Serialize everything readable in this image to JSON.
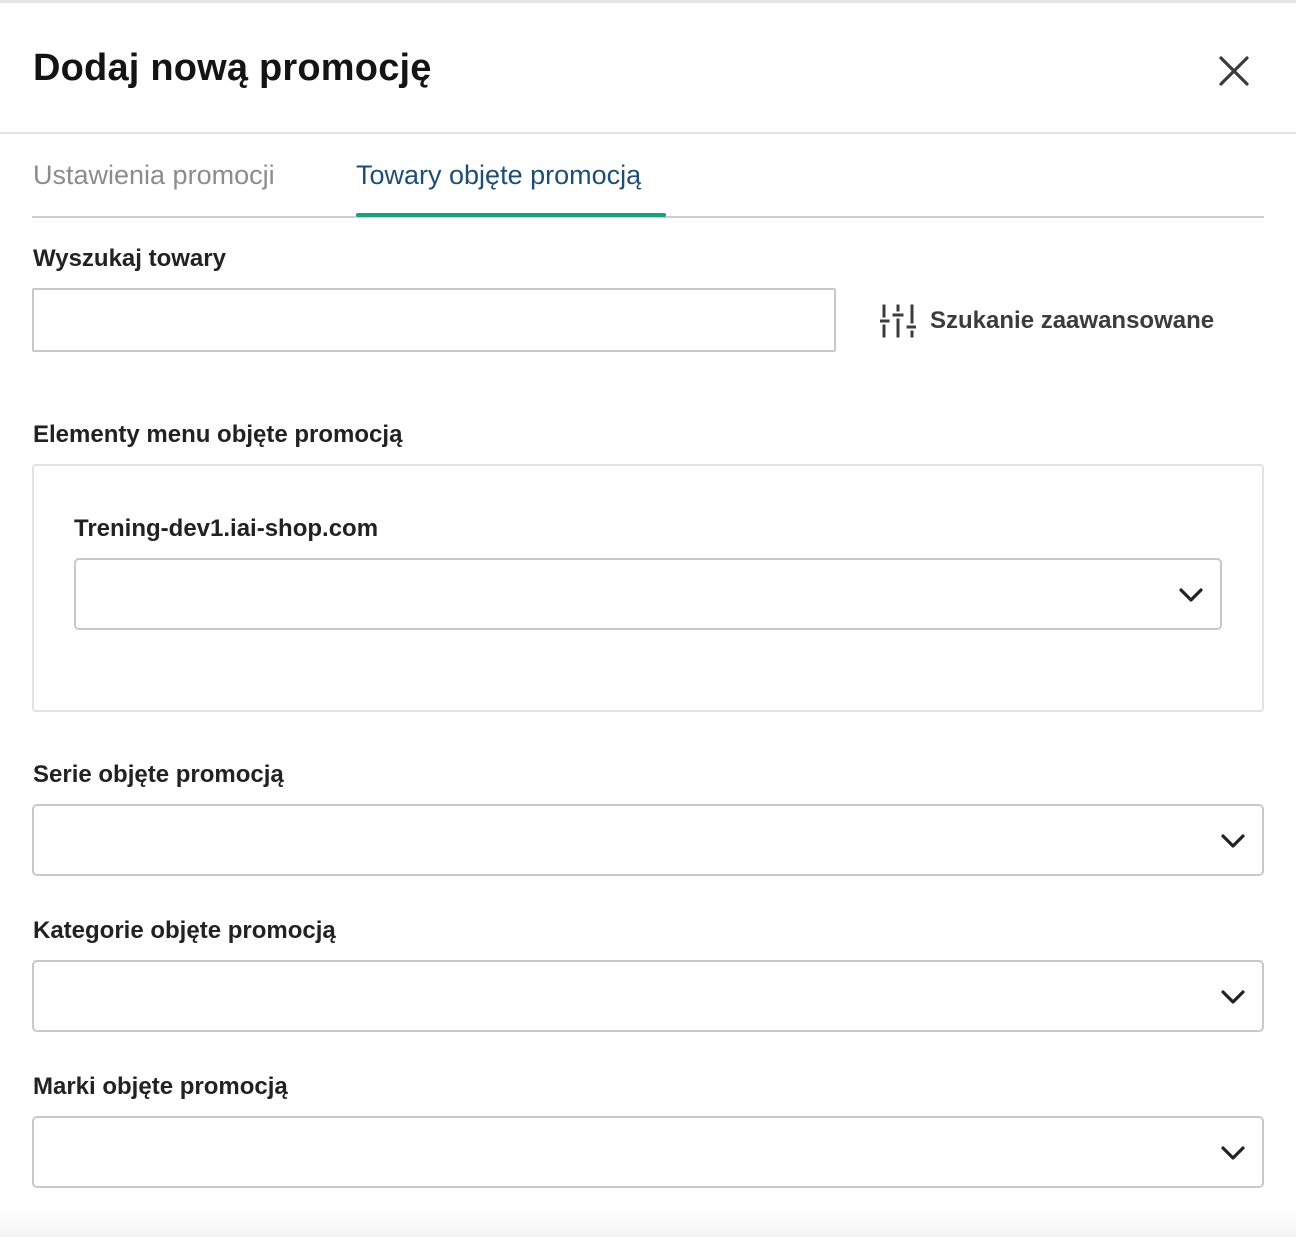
{
  "modal": {
    "title": "Dodaj nową promocję",
    "close_icon": "close-icon"
  },
  "tabs": [
    {
      "label": "Ustawienia promocji",
      "active": false
    },
    {
      "label": "Towary objęte promocją",
      "active": true
    }
  ],
  "search": {
    "label": "Wyszukaj towary",
    "value": "",
    "advanced_label": "Szukanie zaawansowane",
    "advanced_icon": "sliders-icon"
  },
  "menu_elements": {
    "label": "Elementy menu objęte promocją",
    "shop_label": "Trening-dev1.iai-shop.com",
    "select_value": ""
  },
  "series": {
    "label": "Serie objęte promocją",
    "select_value": ""
  },
  "categories": {
    "label": "Kategorie objęte promocją",
    "select_value": ""
  },
  "brands": {
    "label": "Marki objęte promocją",
    "select_value": ""
  },
  "colors": {
    "active_tab": "#1e4e74",
    "active_underline": "#1aa07a",
    "inactive_tab": "#8c8c8c"
  }
}
